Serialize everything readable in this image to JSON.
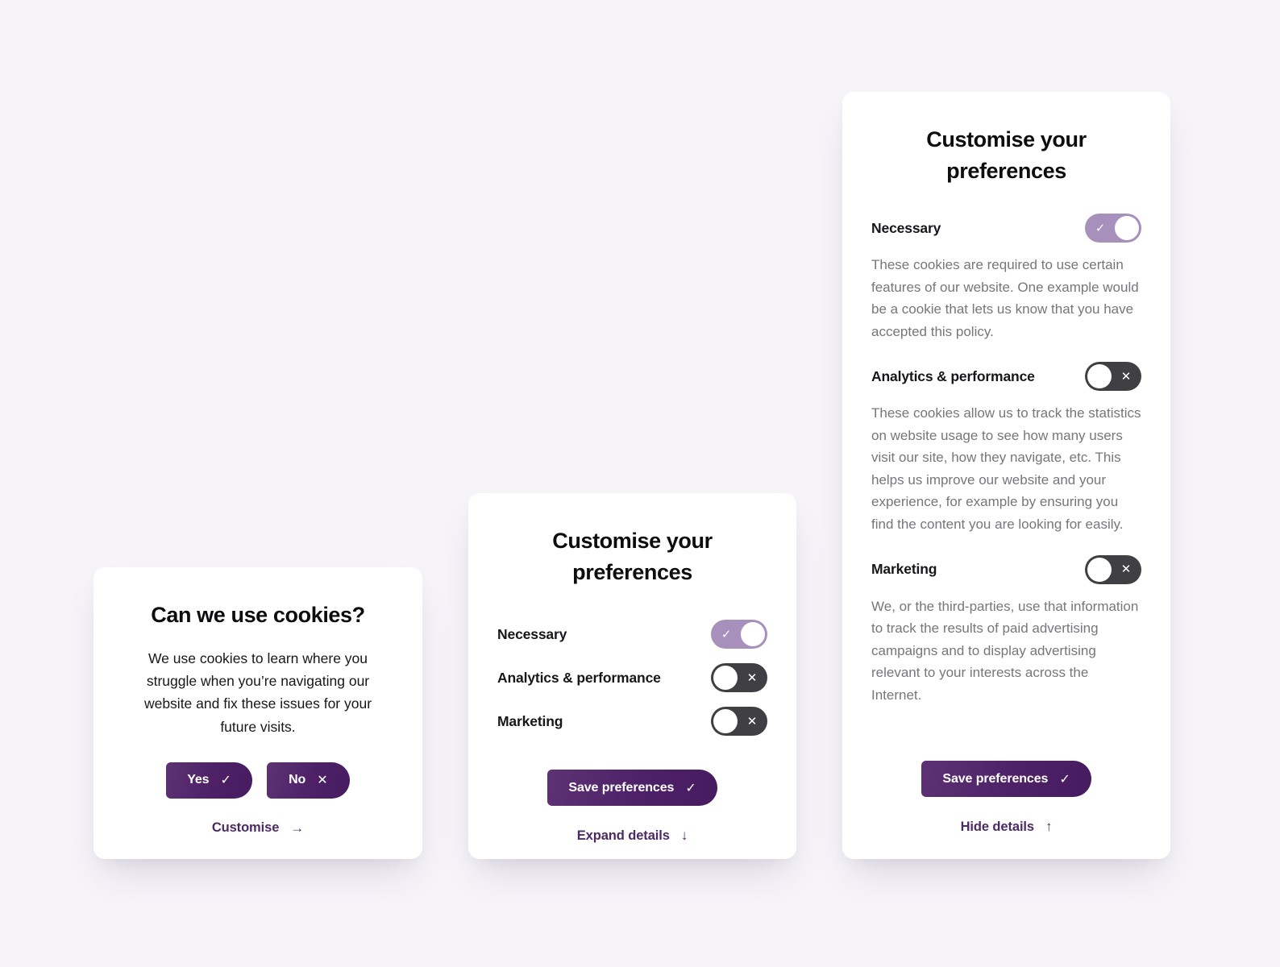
{
  "theme": {
    "page_background": "#f6f4f9",
    "card_background": "#ffffff",
    "accent_purple": "#4c2a63",
    "toggle_on": "#a890bd",
    "toggle_off": "#403f44",
    "body_text": "#17171a",
    "muted_text": "#76767c"
  },
  "consent_card": {
    "title": "Can we use cookies?",
    "body": "We use cookies to learn where you struggle when you’re navigating our website and fix these issues for your future visits.",
    "accept_label": "Yes",
    "accept_icon": "check-icon",
    "accept_glyph": "✓",
    "decline_label": "No",
    "decline_icon": "cross-icon",
    "decline_glyph": "✕",
    "customise_label": "Customise",
    "customise_icon": "arrow-right-icon",
    "customise_glyph": "→"
  },
  "compact_card": {
    "title": "Customise your preferences",
    "preferences": [
      {
        "label": "Necessary",
        "state": "on",
        "glyph": "✓",
        "icon": "check-icon"
      },
      {
        "label": "Analytics & performance",
        "state": "off",
        "glyph": "✕",
        "icon": "cross-icon"
      },
      {
        "label": "Marketing",
        "state": "off",
        "glyph": "✕",
        "icon": "cross-icon"
      }
    ],
    "save_label": "Save preferences",
    "save_glyph": "✓",
    "expand_label": "Expand details",
    "expand_glyph": "↓"
  },
  "expanded_card": {
    "title": "Customise your preferences",
    "preferences": [
      {
        "label": "Necessary",
        "state": "on",
        "glyph": "✓",
        "icon": "check-icon",
        "description": "These cookies are required to use certain features of our website. One example would be a cookie that lets us know that you have accepted this policy."
      },
      {
        "label": "Analytics & performance",
        "state": "off",
        "glyph": "✕",
        "icon": "cross-icon",
        "description": "These cookies allow us to track the statistics on website usage to see how many users visit our site, how they navigate, etc. This helps us improve our website and your experience, for example by ensuring you find the content you are looking for easily."
      },
      {
        "label": "Marketing",
        "state": "off",
        "glyph": "✕",
        "icon": "cross-icon",
        "description": "We, or the third-parties, use that information to track the results of paid advertising campaigns and to display advertising relevant to your interests across the Internet."
      }
    ],
    "save_label": "Save preferences",
    "save_glyph": "✓",
    "hide_label": "Hide details",
    "hide_glyph": "↑"
  }
}
